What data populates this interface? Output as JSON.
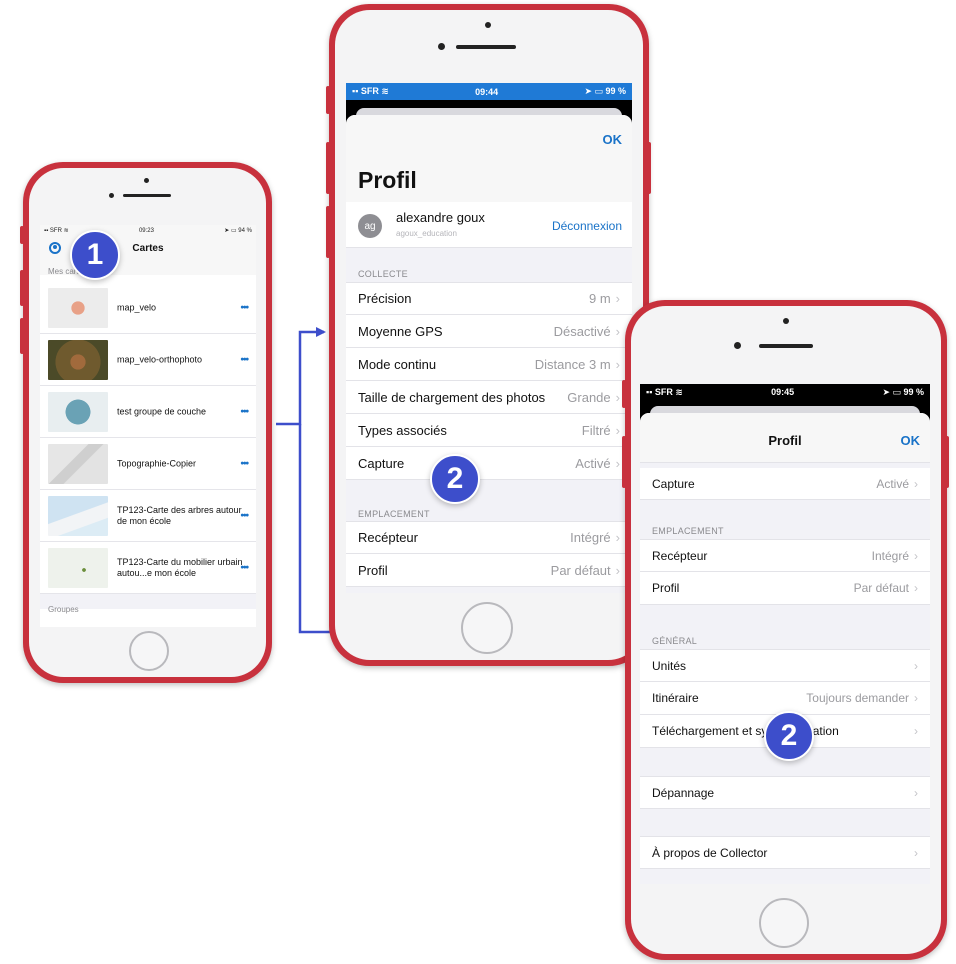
{
  "colors": {
    "accent": "#1a73c8",
    "phone": "#c8313d",
    "badge": "#3d4ecb",
    "connector": "#3d4ecb"
  },
  "phone1": {
    "status": {
      "carrier": "SFR",
      "time": "09:23",
      "battery": "94 %"
    },
    "title": "Cartes",
    "section_maps": "Mes cartes",
    "maps": [
      {
        "name": "map_velo",
        "more": "•••"
      },
      {
        "name": "map_velo-orthophoto",
        "more": "•••"
      },
      {
        "name": "test groupe de couche",
        "more": "•••"
      },
      {
        "name": "Topographie-Copier",
        "more": "•••"
      },
      {
        "name": "TP123-Carte des arbres autour de mon école",
        "more": "•••"
      },
      {
        "name": "TP123-Carte du mobilier urbain autou...e mon école",
        "more": "•••"
      }
    ],
    "section_groups": "Groupes"
  },
  "phone2": {
    "status": {
      "carrier": "SFR",
      "time": "09:44",
      "battery": "99 %"
    },
    "ok": "OK",
    "title": "Profil",
    "user": {
      "initials": "ag",
      "name": "alexandre goux",
      "username": "agoux_education",
      "logout": "Déconnexion"
    },
    "section_collecte": "COLLECTE",
    "collecte": [
      {
        "label": "Précision",
        "value": "9 m"
      },
      {
        "label": "Moyenne GPS",
        "value": "Désactivé"
      },
      {
        "label": "Mode continu",
        "value": "Distance 3 m"
      },
      {
        "label": "Taille de chargement des photos",
        "value": "Grande"
      },
      {
        "label": "Types associés",
        "value": "Filtré"
      },
      {
        "label": "Capture",
        "value": "Activé"
      }
    ],
    "section_emplacement": "EMPLACEMENT",
    "emplacement": [
      {
        "label": "Recépteur",
        "value": "Intégré"
      },
      {
        "label": "Profil",
        "value": "Par défaut"
      }
    ]
  },
  "phone3": {
    "status": {
      "carrier": "SFR",
      "time": "09:45",
      "battery": "99 %"
    },
    "title": "Profil",
    "ok": "OK",
    "capture": {
      "label": "Capture",
      "value": "Activé"
    },
    "section_emplacement": "EMPLACEMENT",
    "emplacement": [
      {
        "label": "Recépteur",
        "value": "Intégré"
      },
      {
        "label": "Profil",
        "value": "Par défaut"
      }
    ],
    "section_general": "GÉNÉRAL",
    "general": [
      {
        "label": "Unités",
        "value": ""
      },
      {
        "label": "Itinéraire",
        "value": "Toujours demander"
      },
      {
        "label": "Téléchargement et synchronisation",
        "value": ""
      }
    ],
    "depannage": "Dépannage",
    "apropos": "À propos de Collector"
  },
  "badges": {
    "one": "1",
    "two": "2"
  }
}
